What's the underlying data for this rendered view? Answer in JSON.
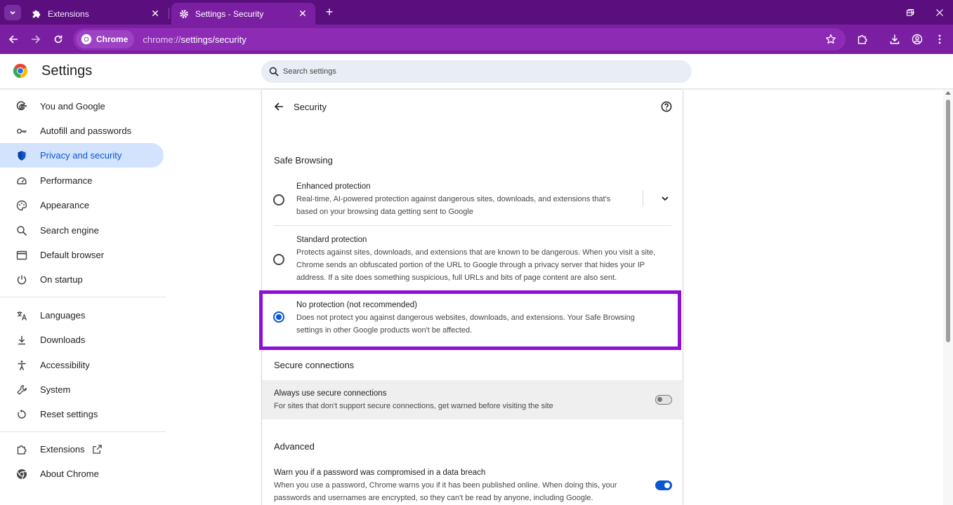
{
  "browser": {
    "tabs": [
      {
        "title": "Extensions",
        "close": "✕",
        "icon": "puzzle-icon"
      },
      {
        "title": "Settings - Security",
        "close": "✕",
        "icon": "gear-icon"
      }
    ],
    "new_tab": "+",
    "omnibox": {
      "chip": "Chrome",
      "url_host": "chrome://",
      "url_path": "settings/security"
    },
    "frame_color": "#5b0f7f",
    "toolbar_color": "#7b1fa2"
  },
  "header": {
    "title": "Settings",
    "search_placeholder": "Search settings"
  },
  "sidebar": {
    "items": [
      {
        "label": "You and Google",
        "icon": "google-icon"
      },
      {
        "label": "Autofill and passwords",
        "icon": "key-icon"
      },
      {
        "label": "Privacy and security",
        "icon": "shield-icon",
        "active": true
      },
      {
        "label": "Performance",
        "icon": "speedometer-icon"
      },
      {
        "label": "Appearance",
        "icon": "palette-icon"
      },
      {
        "label": "Search engine",
        "icon": "search-icon"
      },
      {
        "label": "Default browser",
        "icon": "browser-window-icon"
      },
      {
        "label": "On startup",
        "icon": "power-icon"
      },
      {
        "label": "Languages",
        "icon": "translate-icon"
      },
      {
        "label": "Downloads",
        "icon": "download-icon"
      },
      {
        "label": "Accessibility",
        "icon": "accessibility-icon"
      },
      {
        "label": "System",
        "icon": "wrench-icon"
      },
      {
        "label": "Reset settings",
        "icon": "reset-icon"
      },
      {
        "label": "Extensions",
        "icon": "puzzle-icon",
        "external_icon": "open-in-new-icon"
      },
      {
        "label": "About Chrome",
        "icon": "chrome-icon"
      }
    ],
    "active_color": "#d3e3fd"
  },
  "main": {
    "title": "Security",
    "safe_browsing": {
      "heading": "Safe Browsing",
      "options": [
        {
          "label": "Enhanced protection",
          "description": "Real-time, AI-powered protection against dangerous sites, downloads, and extensions that's based on your browsing data getting sent to Google",
          "selected": false
        },
        {
          "label": "Standard protection",
          "description": "Protects against sites, downloads, and extensions that are known to be dangerous. When you visit a site, Chrome sends an obfuscated portion of the URL to Google through a privacy server that hides your IP address. If a site does something suspicious, full URLs and bits of page content are also sent.",
          "selected": false
        },
        {
          "label": "No protection (not recommended)",
          "description": "Does not protect you against dangerous websites, downloads, and extensions. Your Safe Browsing settings in other Google products won't be affected.",
          "selected": true
        }
      ],
      "highlight_color": "#8d10d6"
    },
    "secure_connections": {
      "heading": "Secure connections",
      "setting": {
        "label": "Always use secure connections",
        "description": "For sites that don't support secure connections, get warned before visiting the site",
        "enabled": false
      }
    },
    "advanced": {
      "heading": "Advanced",
      "setting": {
        "label": "Warn you if a password was compromised in a data breach",
        "description": "When you use a password, Chrome warns you if it has been published online. When doing this, your passwords and usernames are encrypted, so they can't be read by anyone, including Google.",
        "enabled": true
      }
    },
    "accent_color": "#0b57d0"
  }
}
